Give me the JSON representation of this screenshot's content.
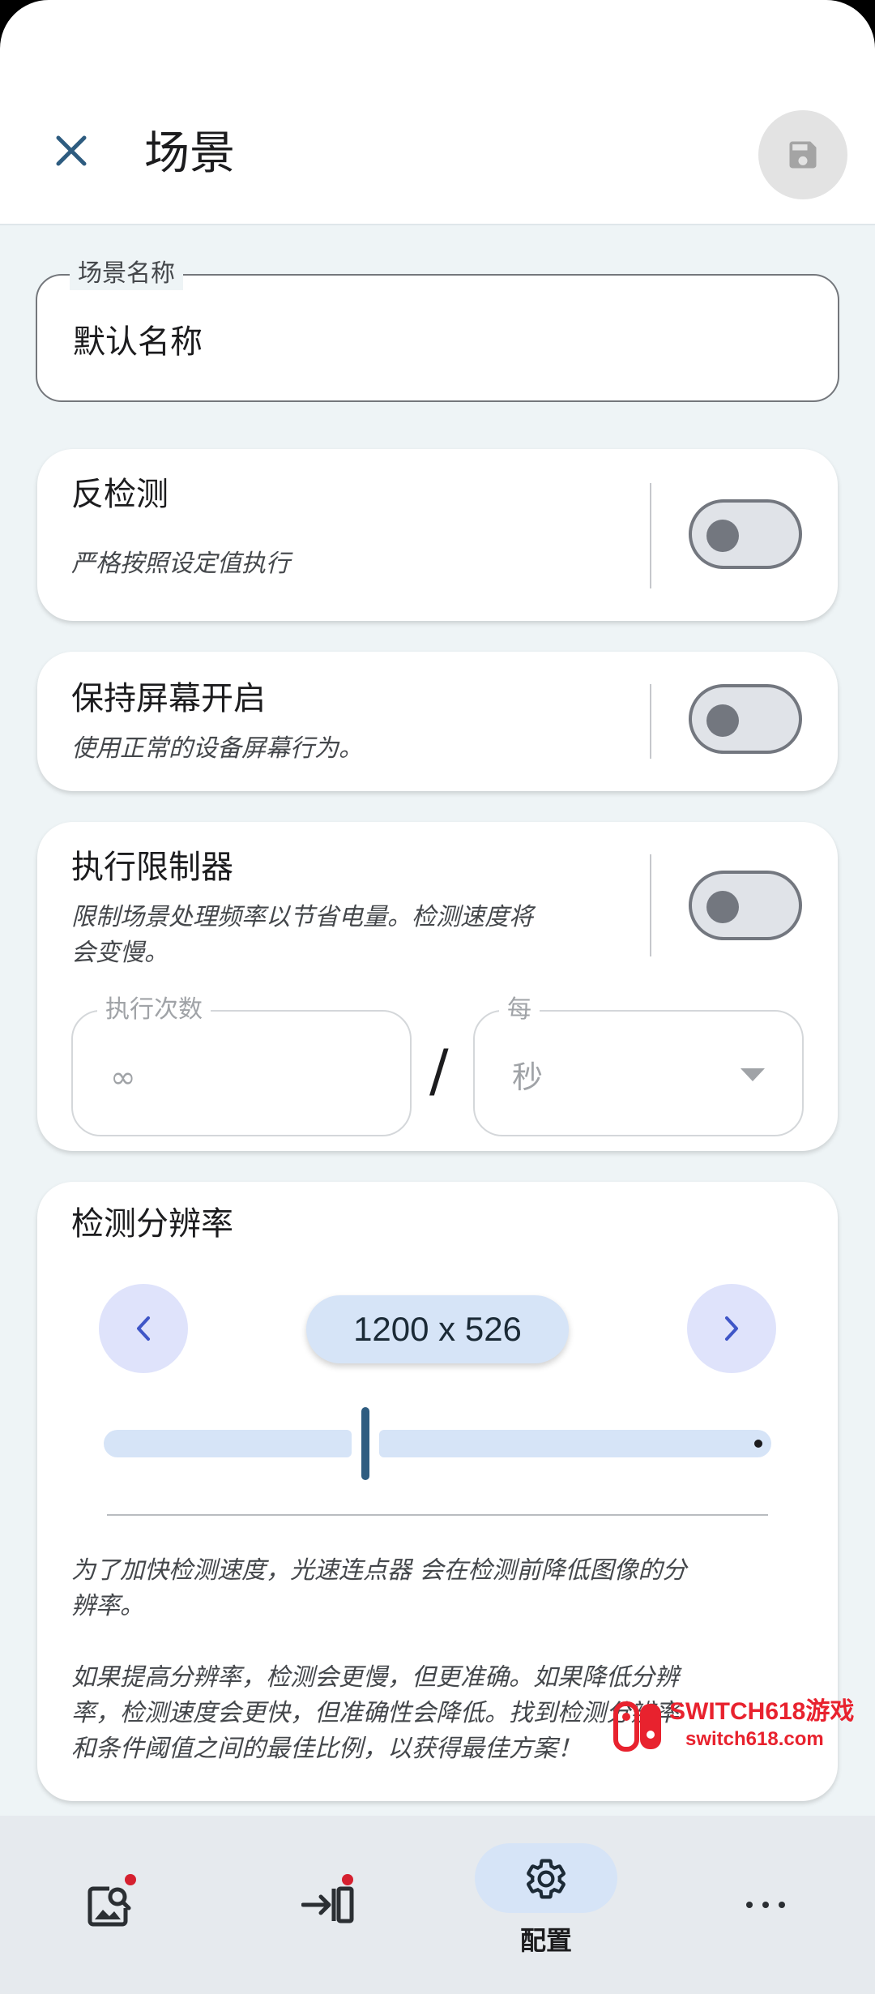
{
  "header": {
    "title": "场景",
    "close_icon": "close-icon",
    "save_icon": "save-icon"
  },
  "name_field": {
    "label": "场景名称",
    "value": "默认名称"
  },
  "anti_detection": {
    "title": "反检测",
    "description": "严格按照设定值执行",
    "enabled": false
  },
  "keep_screen_on": {
    "title": "保持屏幕开启",
    "description": "使用正常的设备屏幕行为。",
    "enabled": false
  },
  "execution_limiter": {
    "title": "执行限制器",
    "description_line1": "限制场景处理频率以节省电量。检测速度将",
    "description_line2": "会变慢。",
    "enabled": false,
    "count_label": "执行次数",
    "count_value": "∞",
    "separator": "/",
    "per_label": "每",
    "per_value": "秒"
  },
  "detection_resolution": {
    "title": "检测分辨率",
    "value": "1200 x 526",
    "slider_fraction": 0.39,
    "info_p1_line1": "为了加快检测速度，光速连点器 会在检测前降低图像的分",
    "info_p1_line2": "辨率。",
    "info_p2_line1": "如果提高分辨率，检测会更慢，但更准确。如果降低分辨",
    "info_p2_line2": "率，检测速度会更快，但准确性会降低。找到检测分辨率",
    "info_p2_line3": "和条件阈值之间的最佳比例，以获得最佳方案！"
  },
  "bottom_nav": {
    "items": [
      {
        "icon": "image-search-icon",
        "badge": true
      },
      {
        "icon": "login-icon",
        "badge": true
      },
      {
        "icon": "gear-icon",
        "label": "配置",
        "active": true
      },
      {
        "icon": "more-horizontal-icon"
      }
    ]
  },
  "watermark": {
    "line1": "SWITCH618游戏",
    "line2": "switch618.com"
  },
  "colors": {
    "accent": "#2e5c80",
    "chip": "#d6e4f7",
    "background": "#eef4f6"
  }
}
